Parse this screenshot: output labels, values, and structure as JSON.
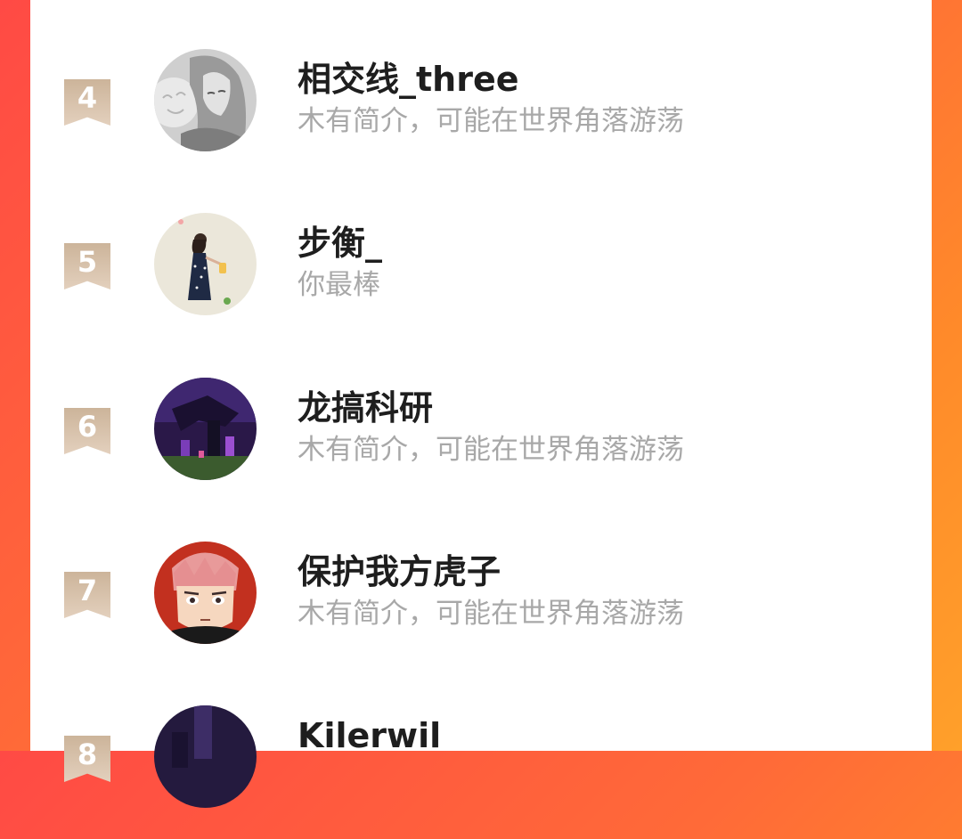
{
  "ranking": {
    "items": [
      {
        "rank": "4",
        "name": "相交线_three",
        "bio": "木有简介，可能在世界角落游荡",
        "avatar_icon": "anime-girl-grayscale"
      },
      {
        "rank": "5",
        "name": "步衡_",
        "bio": "你最棒",
        "avatar_icon": "girl-with-lantern-illustration"
      },
      {
        "rank": "6",
        "name": "龙搞科研",
        "bio": "木有简介，可能在世界角落游荡",
        "avatar_icon": "purple-game-dragon-scene"
      },
      {
        "rank": "7",
        "name": "保护我方虎子",
        "bio": "木有简介，可能在世界角落游荡",
        "avatar_icon": "anime-boy-pink-hair"
      },
      {
        "rank": "8",
        "name": "Kilerwil",
        "bio": "",
        "avatar_icon": "dark-purple-game-scene"
      }
    ]
  },
  "colors": {
    "background_gradient_start": "#ff4a45",
    "background_gradient_end": "#ffa02a",
    "rank_badge": "#d8c2aa",
    "name_text": "#1e1e1e",
    "bio_text": "#a8a8a8"
  }
}
